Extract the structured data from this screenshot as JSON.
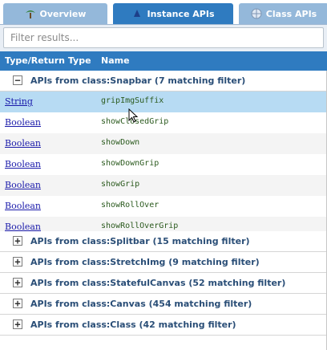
{
  "tabs": [
    {
      "label": "Overview",
      "icon": "palm-tree-icon",
      "active": false
    },
    {
      "label": "Instance APIs",
      "icon": "blue-shape-icon",
      "active": true
    },
    {
      "label": "Class APIs",
      "icon": "globe-icon",
      "active": false
    }
  ],
  "filter": {
    "placeholder": "Filter results...",
    "value": ""
  },
  "grid": {
    "col_type": "Type/Return Type",
    "col_name": "Name",
    "expanded_group": "APIs from class:Snapbar (7 matching filter)",
    "rows": [
      {
        "type": "String",
        "name": "gripImgSuffix"
      },
      {
        "type": "Boolean",
        "name": "showClosedGrip"
      },
      {
        "type": "Boolean",
        "name": "showDown"
      },
      {
        "type": "Boolean",
        "name": "showDownGrip"
      },
      {
        "type": "Boolean",
        "name": "showGrip"
      },
      {
        "type": "Boolean",
        "name": "showRollOver"
      },
      {
        "type": "Boolean",
        "name": "showRollOverGrip"
      }
    ],
    "collapsed_groups": [
      "APIs from class:Splitbar (15 matching filter)",
      "APIs from class:StretchImg (9 matching filter)",
      "APIs from class:StatefulCanvas (52 matching filter)",
      "APIs from class:Canvas (454 matching filter)",
      "APIs from class:Class (42 matching filter)"
    ],
    "collapse_symbol": "−",
    "expand_symbol": "+"
  },
  "colors": {
    "header_bg": "#2f7bc0",
    "tab_inactive": "#94b8da",
    "selected_row": "#b7dbf3",
    "link": "#1a1aaa"
  }
}
